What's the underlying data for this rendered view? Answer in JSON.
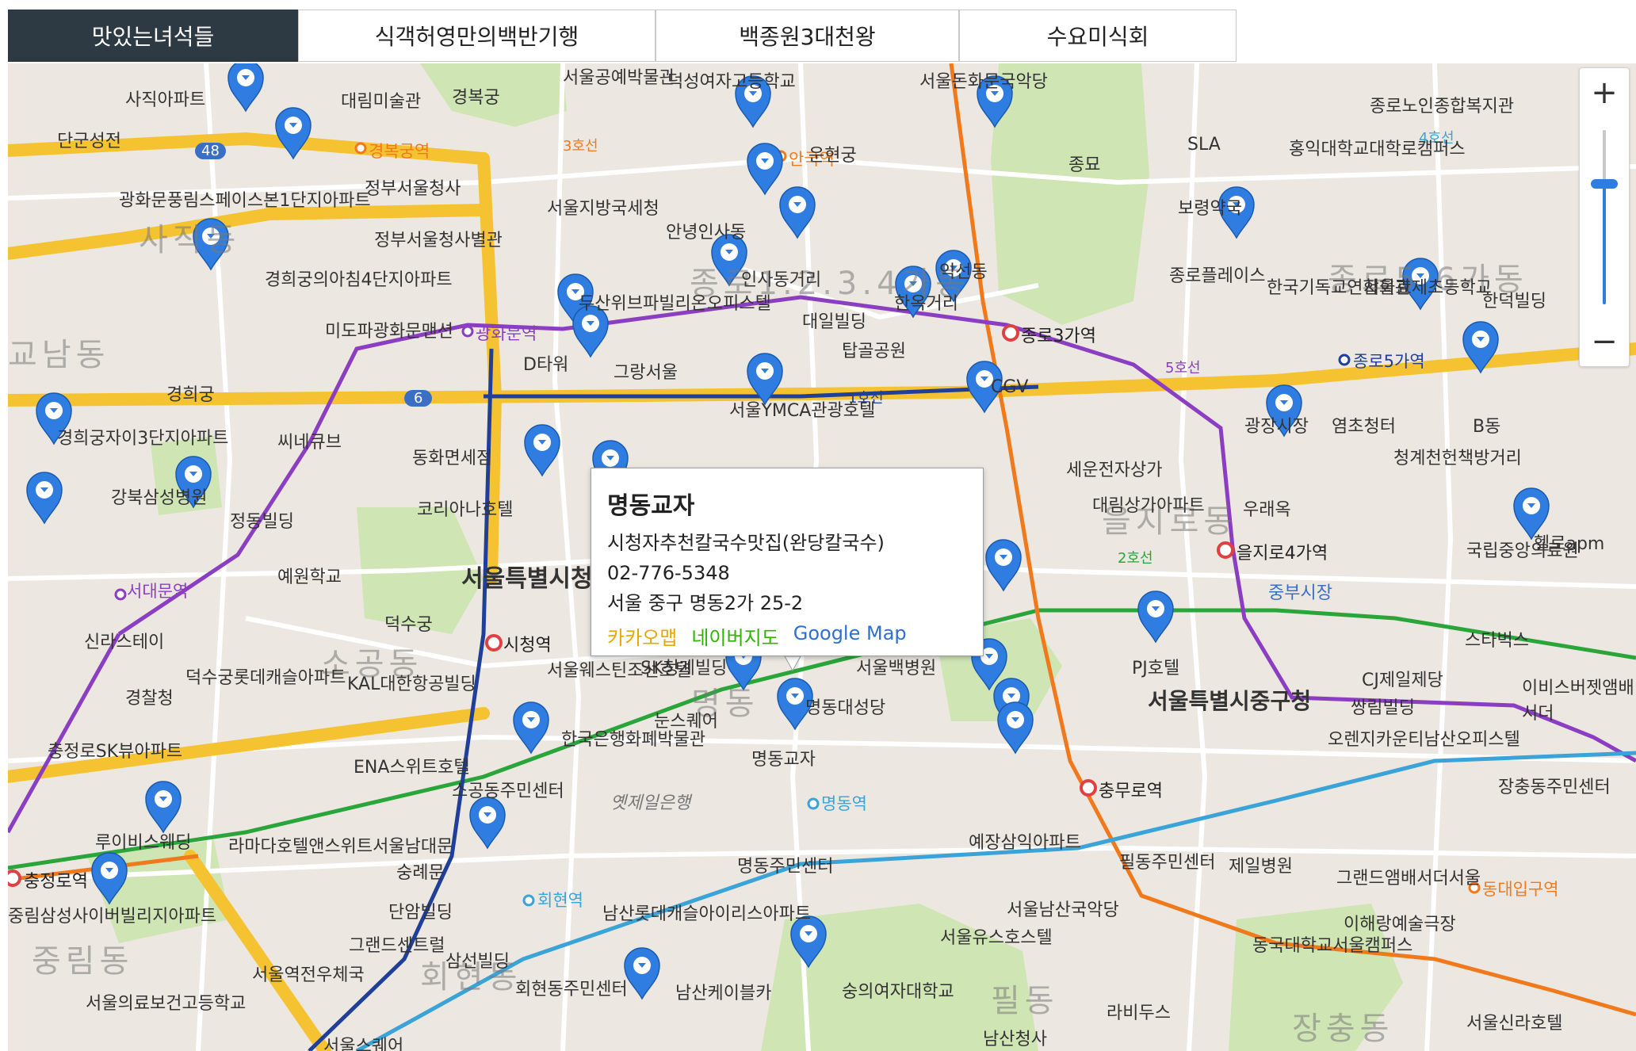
{
  "tabs": [
    {
      "label": "맛있는녀석들",
      "active": true
    },
    {
      "label": "식객허영만의백반기행",
      "active": false
    },
    {
      "label": "백종원3대천왕",
      "active": false
    },
    {
      "label": "수요미식회",
      "active": false
    }
  ],
  "colors": {
    "tab_active_bg": "#2d3a44",
    "marker": "#2f7de1",
    "line1": "#1f3f99",
    "line2": "#2aa53a",
    "line3": "#f07a1b",
    "line4": "#3aa3d8",
    "line5": "#8b3ec1",
    "main_road": "#f5c332",
    "park": "#cfe5b4"
  },
  "zoom": {
    "in_label": "+",
    "out_label": "−"
  },
  "info_window": {
    "title": "명동교자",
    "name": "시청자추천칼국수맛집(완당칼국수)",
    "phone": "02-776-5348",
    "address": "서울 중구 명동2가 25-2",
    "links": {
      "kakao": "카카오맵",
      "naver": "네이버지도",
      "google": "Google Map"
    }
  },
  "map_labels": {
    "areas": [
      "종로1.2.3.4가동",
      "종로5.6가동",
      "을지로동",
      "소공동",
      "명동",
      "회현동",
      "필동",
      "장충동",
      "중림동",
      "사직동",
      "교남동"
    ],
    "stations": [
      "경복궁역",
      "안국역",
      "광화문역",
      "종로3가역",
      "종로5가역",
      "시청역",
      "을지로4가역",
      "충무로역",
      "명동역",
      "회현역",
      "동대입구역",
      "서대문역",
      "충정로역"
    ],
    "line_labels": [
      "3호선",
      "4호선",
      "5호선",
      "2호선",
      "1호선"
    ],
    "places": [
      "대림미술관",
      "사직아파트",
      "단군성전",
      "경복궁",
      "서울공예박물관",
      "덕성여자고등학교",
      "서울돈화문국악당",
      "종로노인종합복지관",
      "정부서울청사",
      "운현궁",
      "종묘",
      "SLA",
      "홍익대학교대학로캠퍼스",
      "광화문풍림스페이스본1단지아파트",
      "서울지방국세청",
      "안녕인사동",
      "보령약국",
      "정부서울청사별관",
      "경희궁의아침4단지아파트",
      "인사동거리",
      "익선동",
      "종로플레이스",
      "한국기독교연합회관",
      "서울효제초등학교",
      "한덕빌딩",
      "두산위브파빌리온오피스텔",
      "대일빌딩",
      "한옥거리",
      "미도파광화문맨션",
      "D타워",
      "그랑서울",
      "탑골공원",
      "경희궁",
      "서울YMCA관광호텔",
      "CGV",
      "광장시장",
      "염초청터",
      "B동",
      "청계천헌책방거리",
      "경희궁자이3단지아파트",
      "씨네큐브",
      "동화면세점",
      "세운전자상가",
      "대림상가아파트",
      "우래옥",
      "헬로apm",
      "강북삼성병원",
      "코리아나호텔",
      "정동빌딩",
      "서울특별시청",
      "국립중앙의료원",
      "예원학교",
      "중부시장",
      "덕수궁",
      "신라스테이",
      "서울웨스틴조선호텔",
      "SK청계빌딩",
      "서울백병원",
      "PJ호텔",
      "스타벅스",
      "덕수궁롯데캐슬아파트",
      "KAL대한항공빌딩",
      "경찰청",
      "명동대성당",
      "CJ제일제당",
      "쌍림빌딩",
      "서울특별시중구청",
      "이비스버젯앰배서더",
      "눈스퀘어",
      "한국은행화폐박물관",
      "명동교자",
      "충정로SK뷰아파트",
      "ENA스위트호텔",
      "소공동주민센터",
      "옛제일은행",
      "오렌지카운티남산오피스텔",
      "장충동주민센터",
      "루이비스웨딩",
      "라마다호텔앤스위트서울남대문",
      "숭례문",
      "명동주민센터",
      "제일병원",
      "예장삼익아파트",
      "필동주민센터",
      "그랜드앰배서더서울",
      "중림삼성사이버빌리지아파트",
      "단암빌딩",
      "남산롯데캐슬아이리스아파트",
      "서울남산국악당",
      "이해랑예술극장",
      "그랜드센트럴",
      "서울유스호스텔",
      "동국대학교서울캠퍼스",
      "서울역전우체국",
      "삼선빌딩",
      "회현동주민센터",
      "남산케이블카",
      "숭의여자대학교",
      "라비두스",
      "서울의료보건고등학교",
      "남산청사",
      "서울신라호텔",
      "서울스퀘어"
    ],
    "route_badges": [
      "48",
      "6"
    ]
  }
}
